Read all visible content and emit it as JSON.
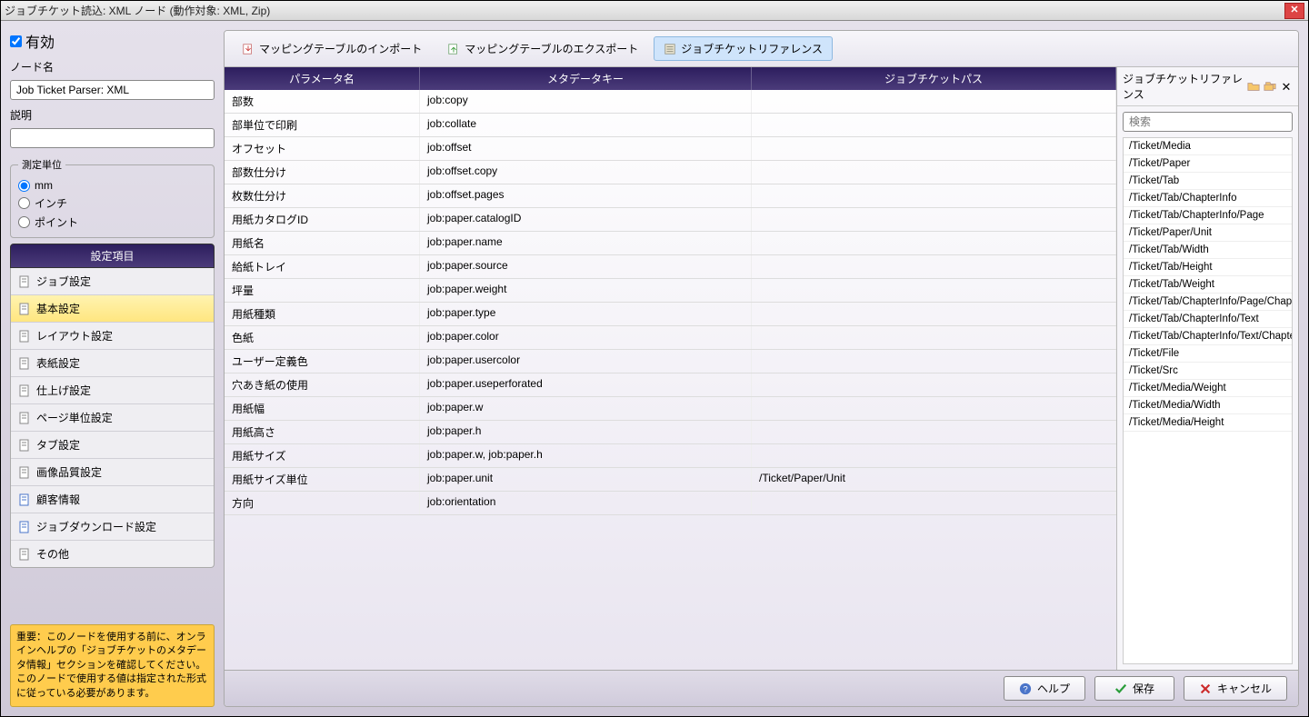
{
  "window": {
    "title": "ジョブチケット読込: XML ノード (動作対象: XML, Zip)"
  },
  "left": {
    "enabled_label": "有効",
    "nodename_label": "ノード名",
    "nodename_value": "Job Ticket Parser: XML",
    "desc_label": "説明",
    "desc_value": "",
    "units_legend": "測定単位",
    "unit_mm": "mm",
    "unit_inch": "インチ",
    "unit_point": "ポイント",
    "settings_header": "設定項目",
    "items": [
      "ジョブ設定",
      "基本設定",
      "レイアウト設定",
      "表紙設定",
      "仕上げ設定",
      "ページ単位設定",
      "タブ設定",
      "画像品質設定",
      "顧客情報",
      "ジョブダウンロード設定",
      "その他"
    ],
    "selected_index": 1,
    "warning": "重要：このノードを使用する前に、オンラインヘルプの「ジョブチケットのメタデータ情報」セクションを確認してください。このノードで使用する値は指定された形式に従っている必要があります。"
  },
  "toolbar": {
    "import_label": "マッピングテーブルのインポート",
    "export_label": "マッピングテーブルのエクスポート",
    "reference_label": "ジョブチケットリファレンス"
  },
  "table": {
    "h1": "パラメータ名",
    "h2": "メタデータキー",
    "h3": "ジョブチケットパス",
    "rows": [
      {
        "p": "部数",
        "k": "job:copy",
        "j": ""
      },
      {
        "p": "部単位で印刷",
        "k": "job:collate",
        "j": ""
      },
      {
        "p": "オフセット",
        "k": "job:offset",
        "j": ""
      },
      {
        "p": "部数仕分け",
        "k": "job:offset.copy",
        "j": ""
      },
      {
        "p": "枚数仕分け",
        "k": "job:offset.pages",
        "j": ""
      },
      {
        "p": "用紙カタログID",
        "k": "job:paper.catalogID",
        "j": ""
      },
      {
        "p": "用紙名",
        "k": "job:paper.name",
        "j": ""
      },
      {
        "p": "給紙トレイ",
        "k": "job:paper.source",
        "j": ""
      },
      {
        "p": "坪量",
        "k": "job:paper.weight",
        "j": ""
      },
      {
        "p": "用紙種類",
        "k": "job:paper.type",
        "j": ""
      },
      {
        "p": "色紙",
        "k": "job:paper.color",
        "j": ""
      },
      {
        "p": "ユーザー定義色",
        "k": "job:paper.usercolor",
        "j": ""
      },
      {
        "p": "穴あき紙の使用",
        "k": "job:paper.useperforated",
        "j": ""
      },
      {
        "p": "用紙幅",
        "k": "job:paper.w",
        "j": ""
      },
      {
        "p": "用紙高さ",
        "k": "job:paper.h",
        "j": ""
      },
      {
        "p": "用紙サイズ",
        "k": "job:paper.w, job:paper.h",
        "j": ""
      },
      {
        "p": "用紙サイズ単位",
        "k": "job:paper.unit",
        "j": "/Ticket/Paper/Unit"
      },
      {
        "p": "方向",
        "k": "job:orientation",
        "j": ""
      }
    ]
  },
  "reference": {
    "title": "ジョブチケットリファレンス",
    "search_placeholder": "検索",
    "items": [
      "/Ticket/Media",
      "/Ticket/Paper",
      "/Ticket/Tab",
      "/Ticket/Tab/ChapterInfo",
      "/Ticket/Tab/ChapterInfo/Page",
      "/Ticket/Paper/Unit",
      "/Ticket/Tab/Width",
      "/Ticket/Tab/Height",
      "/Ticket/Tab/Weight",
      "/Ticket/Tab/ChapterInfo/Page/Chapter",
      "/Ticket/Tab/ChapterInfo/Text",
      "/Ticket/Tab/ChapterInfo/Text/Chapter",
      "/Ticket/File",
      "/Ticket/Src",
      "/Ticket/Media/Weight",
      "/Ticket/Media/Width",
      "/Ticket/Media/Height"
    ]
  },
  "buttons": {
    "help": "ヘルプ",
    "save": "保存",
    "cancel": "キャンセル"
  }
}
